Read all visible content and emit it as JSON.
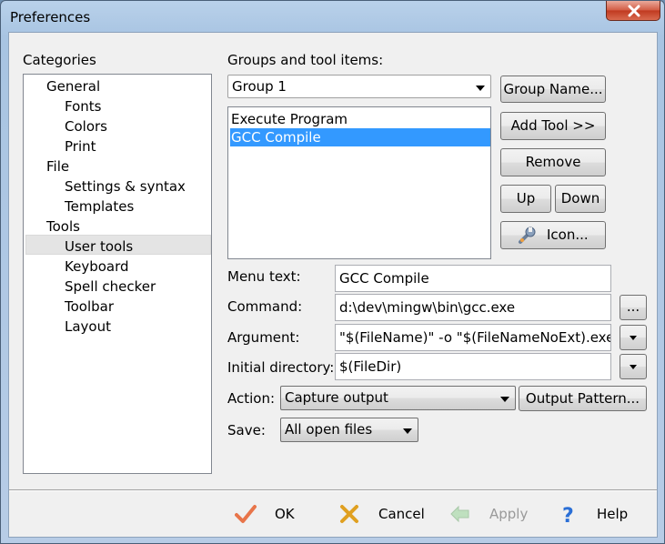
{
  "window": {
    "title": "Preferences"
  },
  "categories": {
    "heading": "Categories",
    "items": [
      {
        "label": "General",
        "level": 0
      },
      {
        "label": "Fonts",
        "level": 1
      },
      {
        "label": "Colors",
        "level": 1
      },
      {
        "label": "Print",
        "level": 1
      },
      {
        "label": "File",
        "level": 0
      },
      {
        "label": "Settings & syntax",
        "level": 1
      },
      {
        "label": "Templates",
        "level": 1
      },
      {
        "label": "Tools",
        "level": 0
      },
      {
        "label": "User tools",
        "level": 1,
        "selected": true
      },
      {
        "label": "Keyboard",
        "level": 1
      },
      {
        "label": "Spell checker",
        "level": 1
      },
      {
        "label": "Toolbar",
        "level": 1
      },
      {
        "label": "Layout",
        "level": 1
      }
    ]
  },
  "groups": {
    "heading": "Groups and tool items:",
    "selected_group": "Group 1",
    "tools": [
      {
        "label": "Execute Program",
        "selected": false
      },
      {
        "label": "GCC Compile",
        "selected": true
      }
    ]
  },
  "buttons": {
    "group_name": "Group Name...",
    "add_tool": "Add Tool >>",
    "remove": "Remove",
    "up": "Up",
    "down": "Down",
    "icon": "Icon...",
    "browse": "...",
    "output_pattern": "Output Pattern..."
  },
  "form": {
    "menu_text": {
      "label": "Menu text:",
      "value": "GCC Compile"
    },
    "command": {
      "label": "Command:",
      "value": "d:\\dev\\mingw\\bin\\gcc.exe"
    },
    "argument": {
      "label": "Argument:",
      "value": "\"$(FileName)\" -o \"$(FileNameNoExt).exe\""
    },
    "initial_directory": {
      "label": "Initial directory:",
      "value": "$(FileDir)"
    },
    "action": {
      "label": "Action:",
      "value": "Capture output"
    },
    "save": {
      "label": "Save:",
      "value": "All open files"
    }
  },
  "footer": {
    "ok": "OK",
    "cancel": "Cancel",
    "apply": "Apply",
    "help": "Help"
  },
  "colors": {
    "selection": "#3399ff",
    "ok_check": "#e8754a",
    "cancel_x": "#e0a020",
    "help": "#2a6fd6"
  }
}
